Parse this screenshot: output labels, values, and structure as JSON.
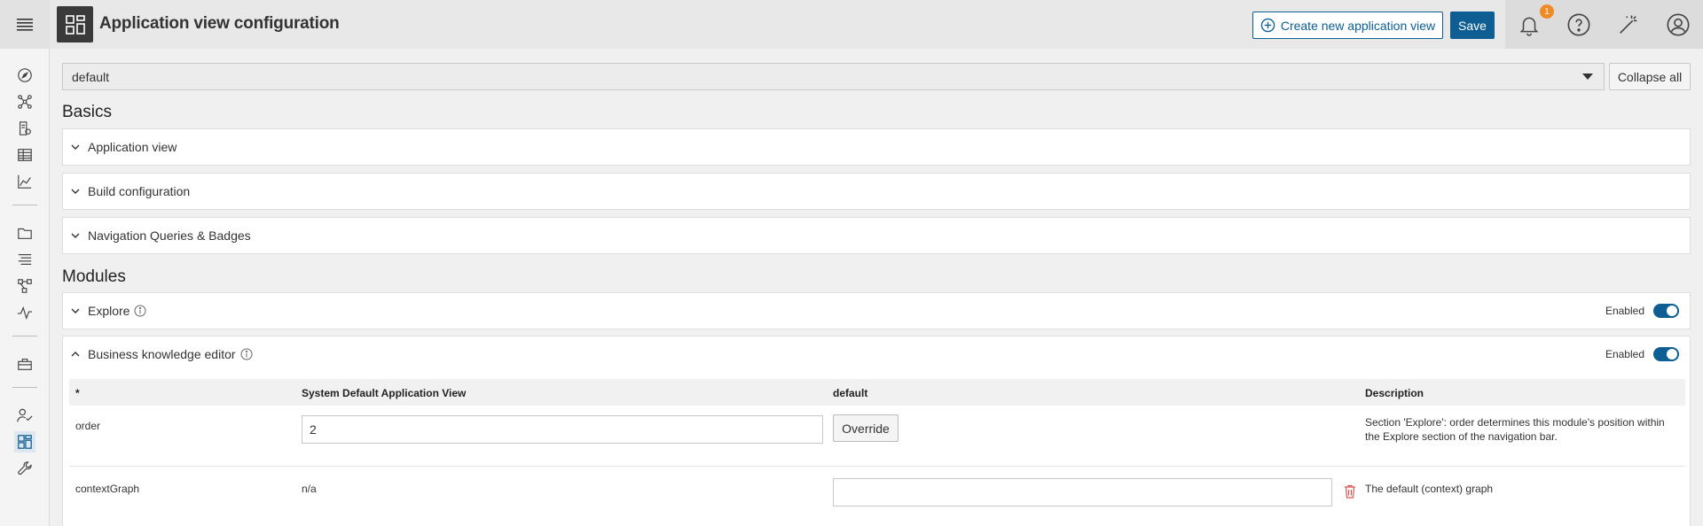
{
  "header": {
    "title": "Application view configuration",
    "create_label": "Create new application view",
    "save_label": "Save",
    "notification_count": "1"
  },
  "view_select": {
    "value": "default"
  },
  "collapse_label": "Collapse all",
  "sections": {
    "basics": "Basics",
    "modules": "Modules"
  },
  "basics_panels": [
    {
      "label": "Application view"
    },
    {
      "label": "Build configuration"
    },
    {
      "label": "Navigation Queries & Badges"
    }
  ],
  "modules": {
    "explore": {
      "label": "Explore",
      "status": "Enabled"
    },
    "bke": {
      "label": "Business knowledge editor",
      "status": "Enabled"
    }
  },
  "table": {
    "headers": [
      "*",
      "System Default Application View",
      "default",
      "Description"
    ],
    "rows": [
      {
        "key": "order",
        "system_default": "2",
        "action": "Override",
        "description": "Section 'Explore': order determines this module's position within the Explore section of the navigation bar."
      },
      {
        "key": "contextGraph",
        "system_default": "n/a",
        "value": "",
        "description": "The default (context) graph"
      }
    ]
  },
  "colors": {
    "accent": "#0e5e93",
    "badge": "#f08a24",
    "danger": "#d9534f"
  }
}
